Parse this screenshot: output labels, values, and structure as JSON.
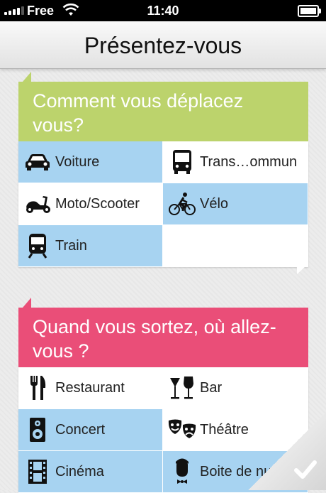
{
  "status_bar": {
    "carrier": "Free",
    "time": "11:40"
  },
  "nav": {
    "title": "Présentez-vous"
  },
  "transport": {
    "question": "Comment vous déplacez vous?",
    "options": [
      {
        "label": "Voiture",
        "icon": "car-icon",
        "selected": true
      },
      {
        "label": "Trans…ommun",
        "icon": "bus-icon",
        "selected": false
      },
      {
        "label": "Moto/Scooter",
        "icon": "scooter-icon",
        "selected": false
      },
      {
        "label": "Vélo",
        "icon": "bicycle-icon",
        "selected": true
      },
      {
        "label": "Train",
        "icon": "train-icon",
        "selected": true
      }
    ]
  },
  "sortie": {
    "question": "Quand vous sortez, où allez-vous ?",
    "options": [
      {
        "label": "Restaurant",
        "icon": "fork-knife-icon",
        "selected": false
      },
      {
        "label": "Bar",
        "icon": "wine-glasses-icon",
        "selected": false
      },
      {
        "label": "Concert",
        "icon": "speaker-icon",
        "selected": true
      },
      {
        "label": "Théâtre",
        "icon": "theater-masks-icon",
        "selected": false
      },
      {
        "label": "Cinéma",
        "icon": "film-icon",
        "selected": true
      },
      {
        "label": "Boite de nuit",
        "icon": "nightclub-icon",
        "selected": true
      }
    ]
  },
  "colors": {
    "transport_header": "#bcd36c",
    "sortie_header": "#ea4e78",
    "selected_cell": "#a7d3f1"
  }
}
